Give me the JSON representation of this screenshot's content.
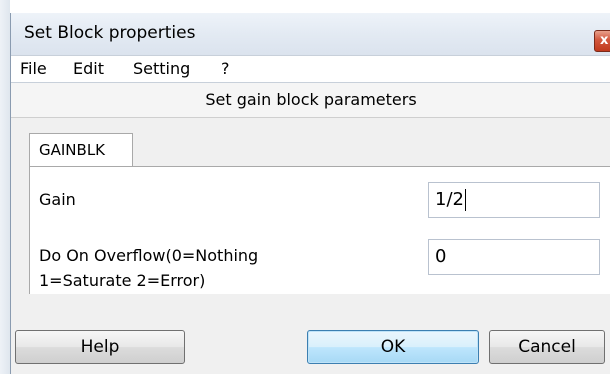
{
  "window": {
    "title": "Set Block properties",
    "close_glyph": "x"
  },
  "menubar": {
    "items": [
      "File",
      "Edit",
      "Setting",
      "?"
    ]
  },
  "header": {
    "subtitle": "Set gain block parameters"
  },
  "tabs": [
    {
      "label": "GAINBLK",
      "selected": true
    }
  ],
  "form": {
    "fields": [
      {
        "label_line1": "Gain",
        "label_line2": "",
        "value": "1/2",
        "focused": true
      },
      {
        "label_line1": "Do On Overflow(0=Nothing",
        "label_line2": "1=Saturate 2=Error)",
        "value": "0",
        "focused": false
      }
    ]
  },
  "buttons": {
    "help": "Help",
    "ok": "OK",
    "cancel": "Cancel"
  },
  "colors": {
    "default_button_border": "#3c7fb1",
    "close_button": "#c0391c"
  }
}
